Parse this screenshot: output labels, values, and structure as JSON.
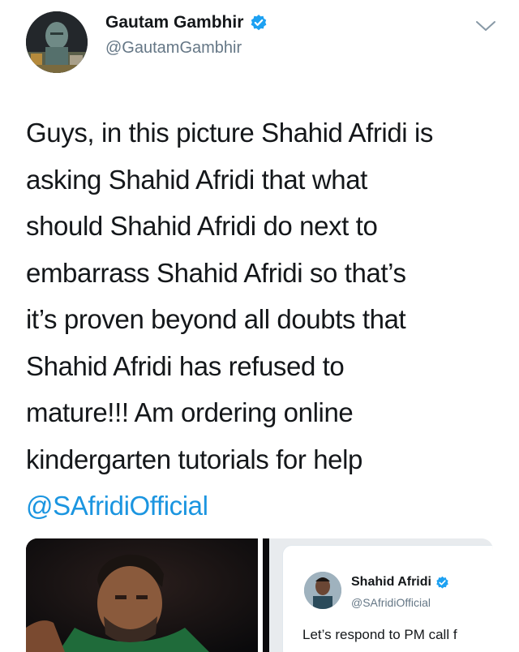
{
  "author": {
    "name": "Gautam Gambhir",
    "handle": "@GautamGambhir",
    "verified": true,
    "verified_color": "#1da1f2"
  },
  "tweet": {
    "lines": [
      "Guys, in this picture Shahid Afridi is",
      "asking Shahid Afridi that what",
      "should Shahid Afridi do next to",
      "embarrass Shahid Afridi so that’s",
      "it’s proven beyond all doubts that",
      "Shahid Afridi has refused to",
      "mature!!! Am ordering online",
      "kindergarten tutorials for help"
    ],
    "mention": "@SAfridiOfficial",
    "mention_color": "#1b95e0"
  },
  "media": {
    "photo_icon": "person-photo",
    "embedded_tweet": {
      "name": "Shahid Afridi",
      "handle": "@SAfridiOfficial",
      "verified": true,
      "text": "Let’s respond to PM call f"
    }
  },
  "icons": {
    "more": "chevron-down-icon",
    "verified": "verified-badge-icon"
  }
}
